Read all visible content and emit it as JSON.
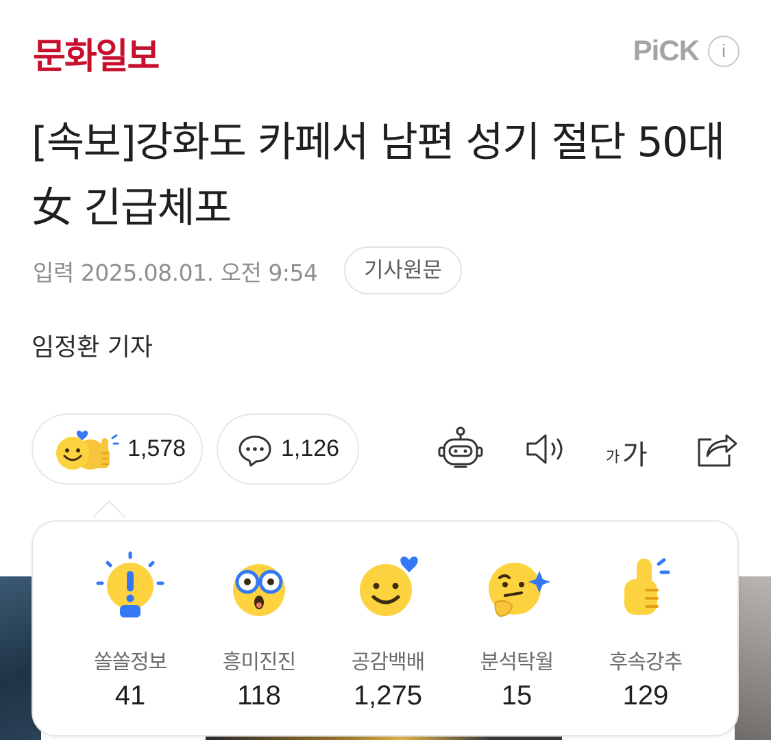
{
  "header": {
    "logo": "문화일보",
    "pick_label": "PiCK",
    "info_icon": "i"
  },
  "article": {
    "title": "[속보]강화도 카페서 남편 성기 절단 50대女 긴급체포",
    "published": "입력 2025.08.01. 오전 9:54",
    "original_button": "기사원문",
    "byline": "임정환 기자"
  },
  "actions": {
    "reaction_count": "1,578",
    "comment_count": "1,126",
    "font_size_small": "가",
    "font_size_large": "가"
  },
  "reactions": [
    {
      "label": "쏠쏠정보",
      "count": "41",
      "icon": "lightbulb-icon"
    },
    {
      "label": "흥미진진",
      "count": "118",
      "icon": "glasses-face-icon"
    },
    {
      "label": "공감백배",
      "count": "1,275",
      "icon": "heart-smile-icon"
    },
    {
      "label": "분석탁월",
      "count": "15",
      "icon": "thinking-face-icon"
    },
    {
      "label": "후속강추",
      "count": "129",
      "icon": "thumbs-up-icon"
    }
  ],
  "colors": {
    "brand": "#c8102e",
    "emoji_yellow": "#fcd33f",
    "accent_blue": "#3478f6"
  }
}
